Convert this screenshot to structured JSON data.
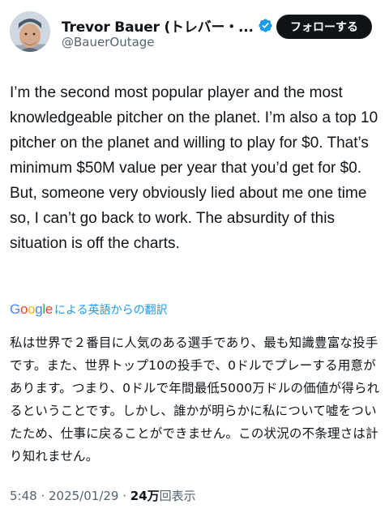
{
  "author": {
    "display_name": "Trevor Bauer (トレバー・...",
    "handle": "@BauerOutage",
    "verified": true,
    "avatar_icon": "profile-photo"
  },
  "follow_button": {
    "label": "フォローする"
  },
  "tweet": {
    "text": "I’m the second most popular player and the most knowledgeable pitcher on the planet. I’m also a top 10 pitcher on the planet and willing to play for $0. That’s minimum $50M value per year that you’d get for $0. But, someone very obviously lied about me one time so, I can’t go back to work. The absurdity of this situation is off the charts."
  },
  "translation": {
    "provider": "Google",
    "label": "による英語からの翻訳",
    "text": "私は世界で２番目に人気のある選手であり、最も知識豊富な投手です。また、世界トップ10の投手で、0ドルでプレーする用意があります。つまり、0ドルで年間最低5000万ドルの価値が得られるということです。しかし、誰かが明らかに私について嘘をついたため、仕事に戻ることができません。この状況の不条理さは計り知れません。"
  },
  "meta": {
    "time": "5:48",
    "separator": " · ",
    "date": "2025/01/29",
    "views_count": "24万",
    "views_label": "回表示"
  },
  "colors": {
    "text": "#0f1419",
    "secondary": "#536471",
    "link": "#1d9bf0",
    "verified": "#1d9bf0",
    "button_bg": "#0f1419"
  }
}
